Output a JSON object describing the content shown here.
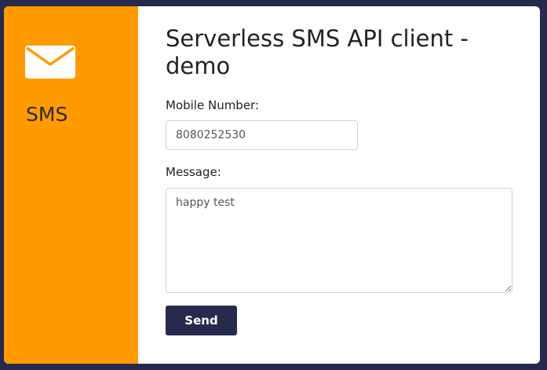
{
  "sidebar": {
    "icon": "envelope-icon",
    "title": "SMS",
    "background": "#ff9b00"
  },
  "main": {
    "title": "Serverless SMS API client - demo",
    "mobile": {
      "label": "Mobile Number:",
      "value": "8080252530"
    },
    "message": {
      "label": "Message:",
      "value": "happy test"
    },
    "send_label": "Send"
  },
  "colors": {
    "page_background": "#262a4d",
    "accent": "#ff9b00",
    "button": "#262a4d"
  }
}
